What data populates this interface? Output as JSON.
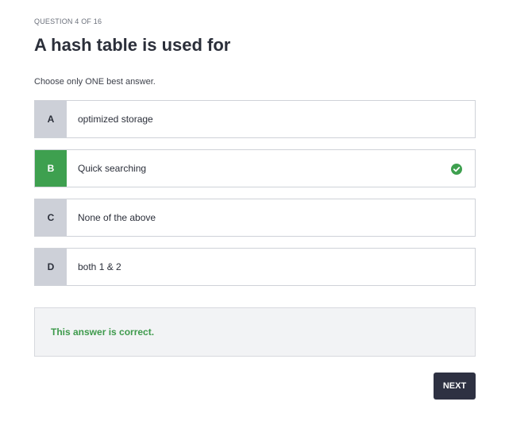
{
  "quiz": {
    "counter": "QUESTION 4 OF 16",
    "question": "A hash table is used for",
    "instruction": "Choose only ONE best answer.",
    "options": [
      {
        "letter": "A",
        "text": "optimized storage"
      },
      {
        "letter": "B",
        "text": "Quick searching"
      },
      {
        "letter": "C",
        "text": "None of the above"
      },
      {
        "letter": "D",
        "text": "both 1 & 2"
      }
    ],
    "selected_option": "B",
    "feedback": "This answer is correct.",
    "next_label": "NEXT"
  },
  "icons": {
    "correct": "check-circle-icon"
  },
  "colors": {
    "correct_green": "#3ea04f",
    "letter_gray": "#cdd0d8",
    "button_dark": "#2e3142",
    "feedback_bg": "#f2f3f5",
    "feedback_text": "#3e9a4c"
  }
}
